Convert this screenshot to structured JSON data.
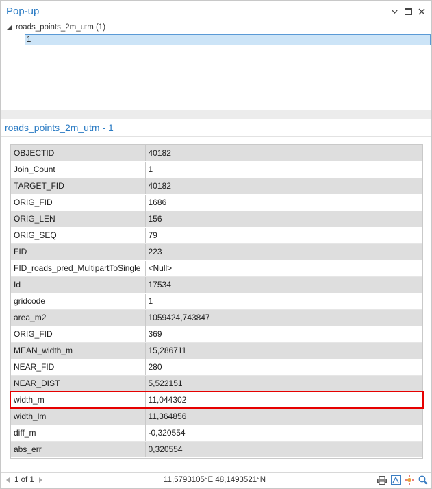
{
  "pane": {
    "title": "Pop-up"
  },
  "tree": {
    "layer_label": "roads_points_2m_utm (1)",
    "feature_label": "1"
  },
  "feature_title": "roads_points_2m_utm - 1",
  "attributes": [
    {
      "field": "OBJECTID",
      "value": "40182"
    },
    {
      "field": "Join_Count",
      "value": "1"
    },
    {
      "field": "TARGET_FID",
      "value": "40182"
    },
    {
      "field": "ORIG_FID",
      "value": "1686"
    },
    {
      "field": "ORIG_LEN",
      "value": "156"
    },
    {
      "field": "ORIG_SEQ",
      "value": "79"
    },
    {
      "field": "FID",
      "value": "223"
    },
    {
      "field": "FID_roads_pred_MultipartToSingle",
      "value": "<Null>"
    },
    {
      "field": "Id",
      "value": "17534"
    },
    {
      "field": "gridcode",
      "value": "1"
    },
    {
      "field": "area_m2",
      "value": "1059424,743847"
    },
    {
      "field": "ORIG_FID",
      "value": "369"
    },
    {
      "field": "MEAN_width_m",
      "value": "15,286711"
    },
    {
      "field": "NEAR_FID",
      "value": "280"
    },
    {
      "field": "NEAR_DIST",
      "value": "5,522151"
    },
    {
      "field": "width_m",
      "value": "11,044302"
    },
    {
      "field": "width_lm",
      "value": "11,364856"
    },
    {
      "field": "diff_m",
      "value": "-0,320554"
    },
    {
      "field": "abs_err",
      "value": "0,320554"
    }
  ],
  "status": {
    "page_info": "1 of 1",
    "coordinates": "11,5793105°E 48,1493521°N"
  },
  "icons": {
    "window": [
      "chevron-down-icon",
      "maximize-icon",
      "close-icon"
    ],
    "tools": [
      "print-icon",
      "zoom-to-icon",
      "flash-icon",
      "pan-to-icon"
    ]
  },
  "colors": {
    "accent": "#2c7cc4",
    "selection": "#cce4f7",
    "highlight": "#e60000"
  }
}
